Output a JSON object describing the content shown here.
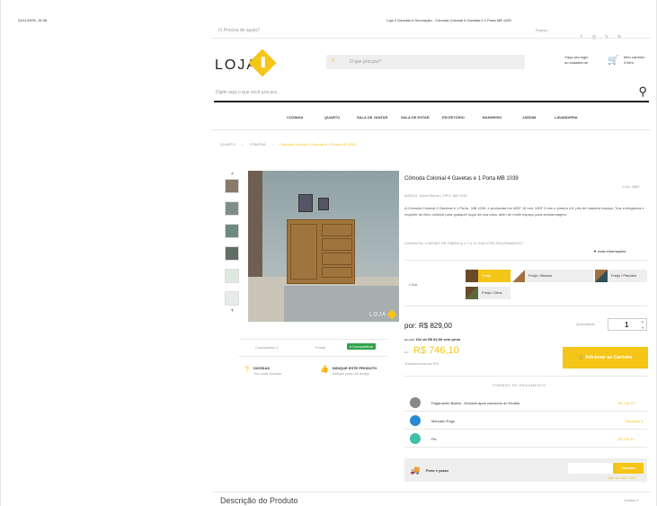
{
  "browser": {
    "datetime": "24/11/2026, 15:38",
    "page_title": "Loja 3 Gavetas e Decoração - Cômoda Colonial 4 Gavetas e 1 Porta MB 1039"
  },
  "topbar": {
    "help_text": "Precisa de ajuda?",
    "login_short": "Registo",
    "social": [
      "f",
      "◎",
      "𝕏",
      "℗"
    ]
  },
  "header": {
    "logo_text": "LOJA",
    "top_search_placeholder": "O que procura?",
    "account_line1": "Faça seu login",
    "account_line2": "ou cadastre-se",
    "cart_line1": "Meu carrinho",
    "cart_line2": "0 item",
    "main_search_placeholder": "Digite aqui o que você procura..."
  },
  "nav": [
    "COZINHA",
    "QUARTO",
    "SALA DE JANTAR",
    "SALA DE ESTAR",
    "ESCRITÓRIO",
    "BANHEIRO",
    "JARDIM",
    "LAVANDERIA"
  ],
  "breadcrumb": [
    "QUARTO",
    "CÔMODA",
    "Cômoda Colonial 4 Gavetas e 1 Porta MB 1039"
  ],
  "breadcrumb_sep": "›",
  "product": {
    "title": "Cômoda Colonial 4 Gavetas e 1 Porta MB 1039",
    "cod": "Cod: 5580",
    "brand_line": "MARCA: Móvel Bento | TIPO: MB 1039",
    "description": "A Cômoda Colonial 4 Gavetas e 1 Porta , MB 1039, é produzida em MDF 15 mm, MDF 3 mm e pintura UV, pés de madeira maciça. Traz a elegância e requinte do linho colonial para qualquer lugar da sua casa, além de muito espaço para armazenagem.",
    "warranty": "GARANTIA: 3 MESES DE FÁBRICA 2 7 A 14 DIAS PÓS FATURAMENTO",
    "more_info": "▼ mais informações",
    "color_label": "• Cor",
    "color_options": [
      {
        "label": "Freijó",
        "swatch": "#6b4a2a"
      },
      {
        "label": "Freijó / Branco",
        "swatch": "#a07040"
      },
      {
        "label": "Freijó / Petróleo",
        "swatch": "#2f4f5a"
      },
      {
        "label": "Freijó / Oliva",
        "swatch": "#5c6a3c"
      }
    ],
    "price_from": "por: R$ 829,00",
    "installments_pre": "ou por ",
    "installments_bold": "10x de R$ 82,90 sem juros",
    "pix_label": "ou",
    "pix_price": "R$ 746,10",
    "pix_note": "Transferência via PIX",
    "qty_label": "Quantidade",
    "qty_value": "1",
    "add_to_cart": "🛒 Adicionar ao Carrinho",
    "accent": "#f5c518"
  },
  "media_bar": {
    "compare": "Comparativo 1",
    "print": "Postal",
    "share": "♦ Compartilhar"
  },
  "help": {
    "q_title": "DÚVIDAS",
    "q_sub": "Tire suas dúvidas",
    "ind_title": "INDIQUE ESTE PRODUTO",
    "ind_sub": "Indique para um amigo"
  },
  "payments": {
    "heading": "FORMAS DE PAGAMENTO",
    "rows": [
      {
        "label": "Pagamento Boleto - Enviado após concluído do Pedido",
        "value": "R$ 746,10",
        "icon_color": "#888"
      },
      {
        "label": "Mercado Pago",
        "value": "Detalhes ∨",
        "icon_color": "#2a8ad1"
      },
      {
        "label": "Pix",
        "value": "R$ 746,10",
        "icon_color": "#3fbfa6"
      }
    ]
  },
  "shipping": {
    "label": "Frete e prazo",
    "button": "Calcular",
    "link": "Não sei meu CEP"
  },
  "footer_section": {
    "title": "Descrição do Produto",
    "toggle": "Ocultar ∧"
  }
}
